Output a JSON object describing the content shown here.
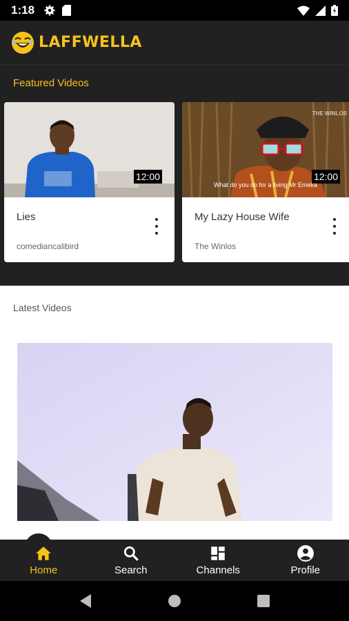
{
  "status_bar": {
    "time": "1:18"
  },
  "app_bar": {
    "brand": "LAFFWELLA"
  },
  "featured": {
    "title": "Featured Videos",
    "items": [
      {
        "title": "Lies",
        "channel": "comediancalibird",
        "duration": "12:00"
      },
      {
        "title": "My Lazy House Wife",
        "channel": "The Winlos",
        "duration": "12:00",
        "watermark": "THE WINLOS",
        "subtitle": "What do you do for a living Mr Emeka"
      }
    ]
  },
  "latest": {
    "title": "Latest Videos"
  },
  "bottom_nav": {
    "items": [
      {
        "label": "Home",
        "icon": "home-icon",
        "active": true
      },
      {
        "label": "Search",
        "icon": "search-icon"
      },
      {
        "label": "Channels",
        "icon": "channels-icon"
      },
      {
        "label": "Profile",
        "icon": "profile-icon"
      }
    ]
  },
  "colors": {
    "accent": "#f6c21b",
    "bar": "#212121",
    "background": "#ffffff"
  }
}
